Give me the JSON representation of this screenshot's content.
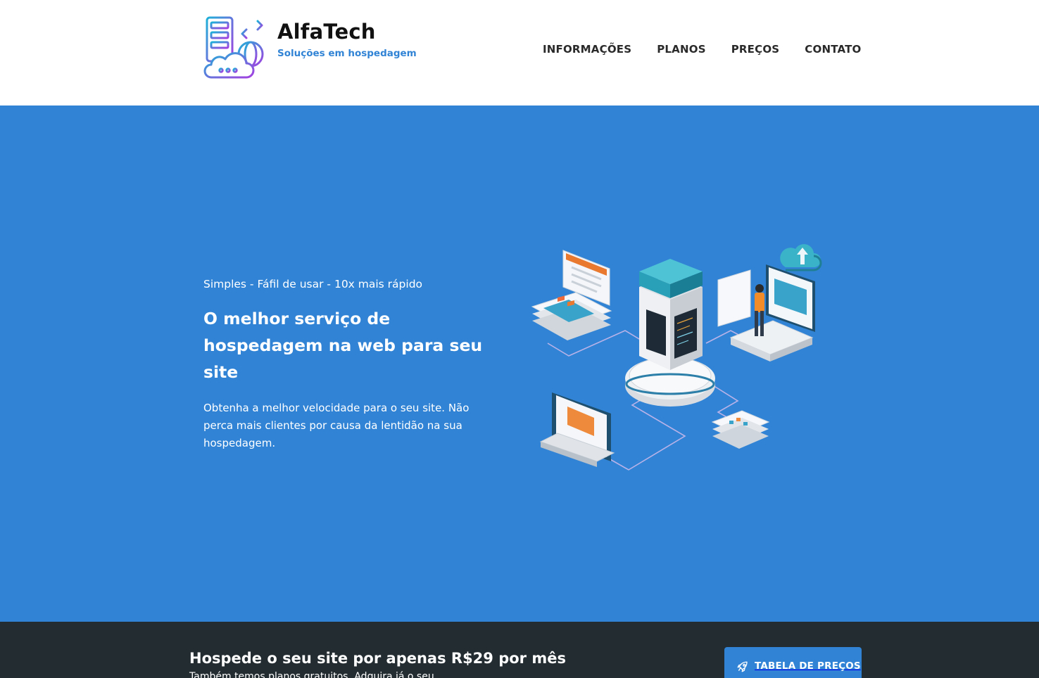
{
  "brand": {
    "name": "AlfaTech",
    "tagline": "Soluções em hospedagem"
  },
  "nav": {
    "items": [
      {
        "label": "INFORMAÇÕES"
      },
      {
        "label": "PLANOS"
      },
      {
        "label": "PREÇOS"
      },
      {
        "label": "CONTATO"
      }
    ]
  },
  "hero": {
    "kicker": "Simples - Fáfil de usar - 10x mais rápido",
    "title": "O melhor serviço de hospedagem na web para seu site",
    "text": "Obtenha a melhor velocidade para o seu site. Não perca mais clientes por causa da lentidão na sua hospedagem.",
    "illustration_icon": "server-cloud-illustration"
  },
  "cta": {
    "title": "Hospede o seu site por apenas R$29 por mês",
    "subtitle": "Também temos planos gratuitos. Adquira já o seu",
    "button_label": "TABELA DE PREÇOS",
    "button_icon": "rocket-icon"
  },
  "colors": {
    "primary": "#3184d5",
    "dark": "#232c31",
    "nav_text": "#2a2a2a",
    "white": "#ffffff"
  }
}
